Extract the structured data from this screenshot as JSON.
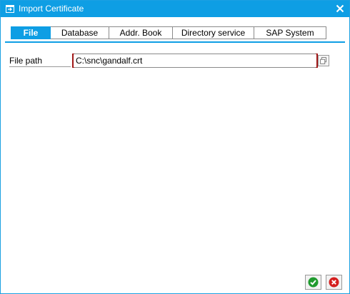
{
  "window": {
    "title": "Import Certificate",
    "icons": {
      "title": "import-window-icon",
      "close": "close-icon"
    }
  },
  "tabs": [
    {
      "label": "File",
      "active": true
    },
    {
      "label": "Database",
      "active": false
    },
    {
      "label": "Addr. Book",
      "active": false
    },
    {
      "label": "Directory service",
      "active": false
    },
    {
      "label": "SAP System",
      "active": false
    }
  ],
  "form": {
    "file_path_label": "File path",
    "file_path_value": "C:\\snc\\gandalf.crt",
    "value_help_icon": "value-help-icon"
  },
  "footer": {
    "ok_icon": "green-check-icon",
    "cancel_icon": "red-cancel-icon"
  },
  "colors": {
    "accent": "#0e9ee4",
    "required_marker": "#a01818",
    "ok_green": "#1f9a2e",
    "cancel_red": "#d41f1f"
  }
}
